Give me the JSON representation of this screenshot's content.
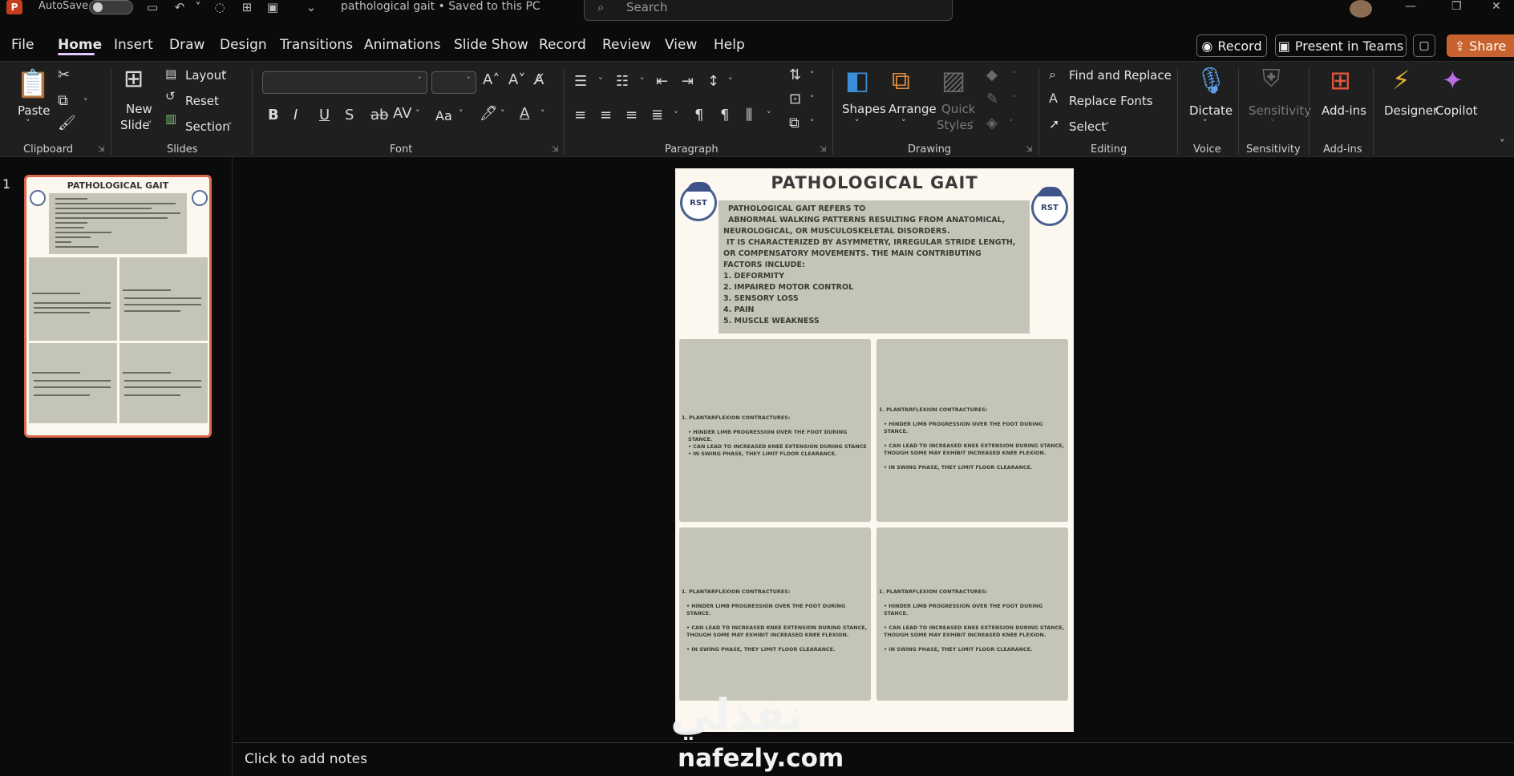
{
  "titlebar": {
    "autosave_label": "AutoSave",
    "document_title": "pathological gait • Saved to this PC",
    "search_placeholder": "Search"
  },
  "menu": {
    "tabs": [
      "File",
      "Home",
      "Insert",
      "Draw",
      "Design",
      "Transitions",
      "Animations",
      "Slide Show",
      "Record",
      "Review",
      "View",
      "Help"
    ],
    "active_tab": "Home",
    "record_label": "Record",
    "present_teams_label": "Present in Teams",
    "share_label": "Share"
  },
  "ribbon": {
    "clipboard": {
      "paste": "Paste",
      "group": "Clipboard"
    },
    "slides": {
      "new_slide_line1": "New",
      "new_slide_line2": "Slide",
      "layout": "Layout",
      "reset": "Reset",
      "section": "Section",
      "group": "Slides"
    },
    "font": {
      "group": "Font",
      "case_label": "Aa"
    },
    "paragraph": {
      "group": "Paragraph"
    },
    "drawing": {
      "shapes": "Shapes",
      "arrange": "Arrange",
      "quick_styles_line1": "Quick",
      "quick_styles_line2": "Styles",
      "group": "Drawing"
    },
    "editing": {
      "find_replace": "Find and Replace",
      "replace_fonts": "Replace Fonts",
      "select": "Select",
      "group": "Editing"
    },
    "voice": {
      "dictate": "Dictate",
      "group": "Voice"
    },
    "sensitivity": {
      "sensitivity": "Sensitivity",
      "group": "Sensitivity"
    },
    "addins": {
      "addins": "Add-ins",
      "group": "Add-ins"
    },
    "designer": "Designer",
    "copilot": "Copilot"
  },
  "thumbnails": [
    {
      "number": "1",
      "title": "PATHOLOGICAL GAIT"
    }
  ],
  "slide": {
    "title": "PATHOLOGICAL GAIT",
    "seal_text": "RST",
    "intro_lines": [
      "PATHOLOGICAL GAIT REFERS TO",
      "ABNORMAL WALKING PATTERNS RESULTING FROM ANATOMICAL,",
      "NEUROLOGICAL,  OR MUSCULOSKELETAL DISORDERS.",
      "IT IS CHARACTERIZED BY ASYMMETRY, IRREGULAR STRIDE LENGTH,",
      "OR COMPENSATORY MOVEMENTS. THE MAIN CONTRIBUTING",
      "FACTORS INCLUDE:",
      "1. DEFORMITY",
      "2. IMPAIRED MOTOR CONTROL",
      "3. SENSORY LOSS",
      "4. PAIN",
      "5. MUSCLE WEAKNESS"
    ],
    "panels": [
      {
        "heading": "1. PLANTARFLEXION CONTRACTURES:",
        "b1": "• HINDER LIMB PROGRESSION OVER THE FOOT DURING STANCE.",
        "b2": "• CAN LEAD TO INCREASED KNEE EXTENSION DURING STANCE",
        "b3": "• IN SWING PHASE, THEY LIMIT FLOOR CLEARANCE."
      },
      {
        "heading": "1. PLANTARFLEXION CONTRACTURES:",
        "b1": "• HINDER LIMB PROGRESSION OVER THE FOOT DURING STANCE.",
        "b2": "• CAN LEAD TO INCREASED KNEE EXTENSION DURING STANCE, THOUGH SOME MAY EXHIBIT INCREASED KNEE FLEXION.",
        "b3": "• IN SWING PHASE, THEY LIMIT FLOOR CLEARANCE."
      },
      {
        "heading": "1. PLANTARFLEXION CONTRACTURES:",
        "b1": "• HINDER LIMB PROGRESSION OVER THE FOOT DURING STANCE.",
        "b2": "• CAN LEAD TO INCREASED KNEE EXTENSION DURING STANCE, THOUGH SOME MAY EXHIBIT INCREASED KNEE FLEXION.",
        "b3": "• IN SWING PHASE, THEY LIMIT FLOOR CLEARANCE."
      },
      {
        "heading": "1. PLANTARFLEXION CONTRACTURES:",
        "b1": "• HINDER LIMB PROGRESSION OVER THE FOOT DURING STANCE.",
        "b2": "• CAN LEAD TO INCREASED KNEE EXTENSION DURING STANCE, THOUGH SOME MAY EXHIBIT INCREASED KNEE FLEXION.",
        "b3": "• IN SWING PHASE, THEY LIMIT FLOOR CLEARANCE."
      }
    ]
  },
  "notes": {
    "placeholder": "Click to add notes"
  },
  "watermark": {
    "arabic": "نفذلي",
    "latin": "nafezly.com"
  },
  "colors": {
    "accent_share": "#c8622e",
    "thumb_border": "#d8664a",
    "panel_bg": "#c4c5b8",
    "slide_bg": "#fdf8ef",
    "seal_blue": "#4a6090"
  }
}
